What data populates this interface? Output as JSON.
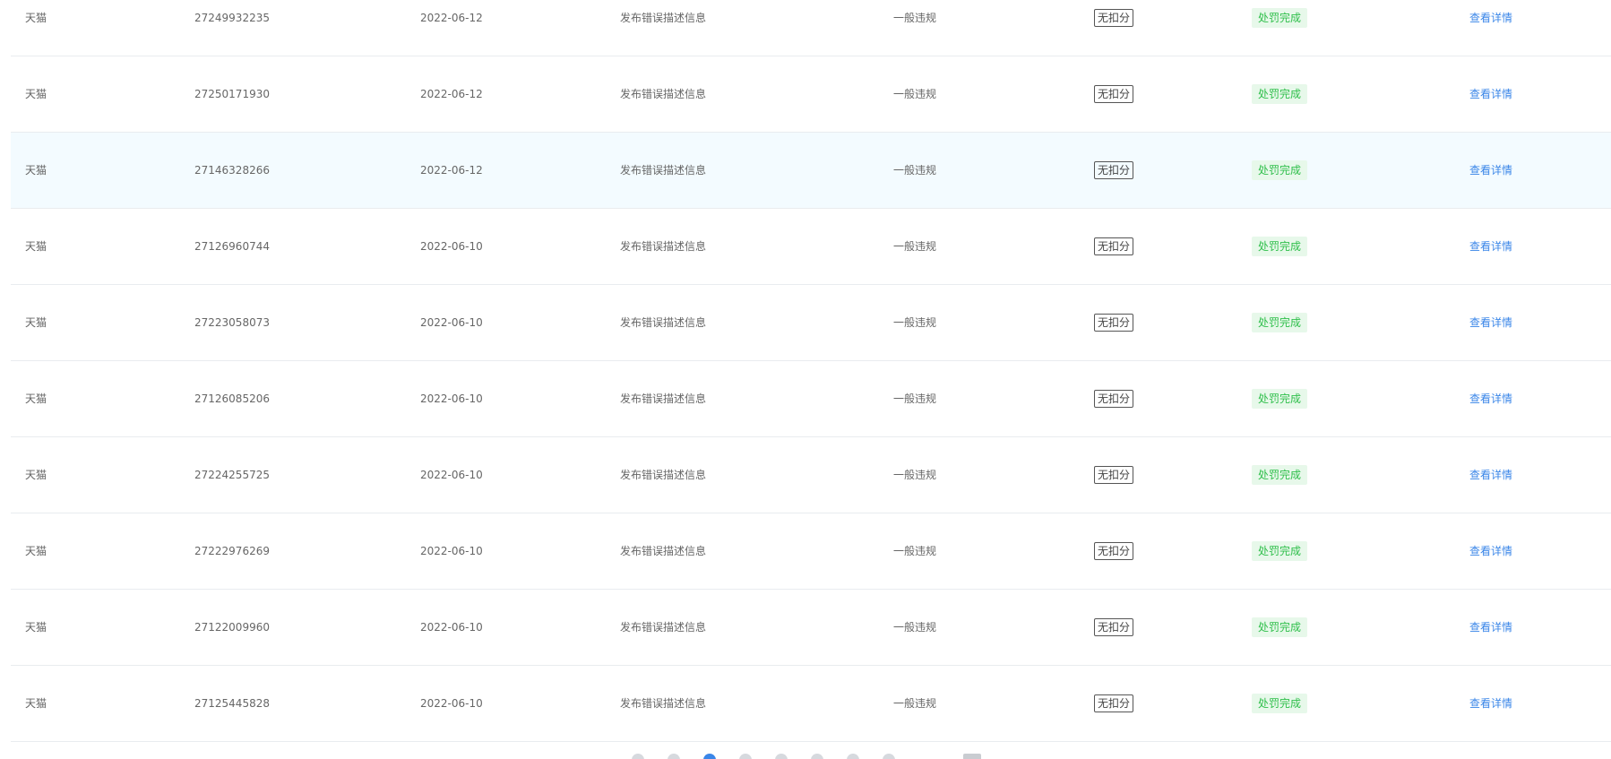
{
  "columns": {
    "action_label": "查看详情"
  },
  "rows": [
    {
      "platform": "天猫",
      "id": "27249932235",
      "date": "2022-06-12",
      "reason": "发布错误描述信息",
      "level": "一般违规",
      "points": "无扣分",
      "status": "处罚完成",
      "action": "查看详情"
    },
    {
      "platform": "天猫",
      "id": "27250171930",
      "date": "2022-06-12",
      "reason": "发布错误描述信息",
      "level": "一般违规",
      "points": "无扣分",
      "status": "处罚完成",
      "action": "查看详情"
    },
    {
      "platform": "天猫",
      "id": "27146328266",
      "date": "2022-06-12",
      "reason": "发布错误描述信息",
      "level": "一般违规",
      "points": "无扣分",
      "status": "处罚完成",
      "action": "查看详情",
      "hovered": true
    },
    {
      "platform": "天猫",
      "id": "27126960744",
      "date": "2022-06-10",
      "reason": "发布错误描述信息",
      "level": "一般违规",
      "points": "无扣分",
      "status": "处罚完成",
      "action": "查看详情"
    },
    {
      "platform": "天猫",
      "id": "27223058073",
      "date": "2022-06-10",
      "reason": "发布错误描述信息",
      "level": "一般违规",
      "points": "无扣分",
      "status": "处罚完成",
      "action": "查看详情"
    },
    {
      "platform": "天猫",
      "id": "27126085206",
      "date": "2022-06-10",
      "reason": "发布错误描述信息",
      "level": "一般违规",
      "points": "无扣分",
      "status": "处罚完成",
      "action": "查看详情"
    },
    {
      "platform": "天猫",
      "id": "27224255725",
      "date": "2022-06-10",
      "reason": "发布错误描述信息",
      "level": "一般违规",
      "points": "无扣分",
      "status": "处罚完成",
      "action": "查看详情"
    },
    {
      "platform": "天猫",
      "id": "27222976269",
      "date": "2022-06-10",
      "reason": "发布错误描述信息",
      "level": "一般违规",
      "points": "无扣分",
      "status": "处罚完成",
      "action": "查看详情"
    },
    {
      "platform": "天猫",
      "id": "27122009960",
      "date": "2022-06-10",
      "reason": "发布错误描述信息",
      "level": "一般违规",
      "points": "无扣分",
      "status": "处罚完成",
      "action": "查看详情"
    },
    {
      "platform": "天猫",
      "id": "27125445828",
      "date": "2022-06-10",
      "reason": "发布错误描述信息",
      "level": "一般违规",
      "points": "无扣分",
      "status": "处罚完成",
      "action": "查看详情"
    }
  ],
  "colors": {
    "status_text": "#2fbf4b",
    "status_bg": "#e7f8ea",
    "link": "#3a86e8",
    "hover_row_bg": "#f3fbff",
    "border": "#e9ecef"
  }
}
